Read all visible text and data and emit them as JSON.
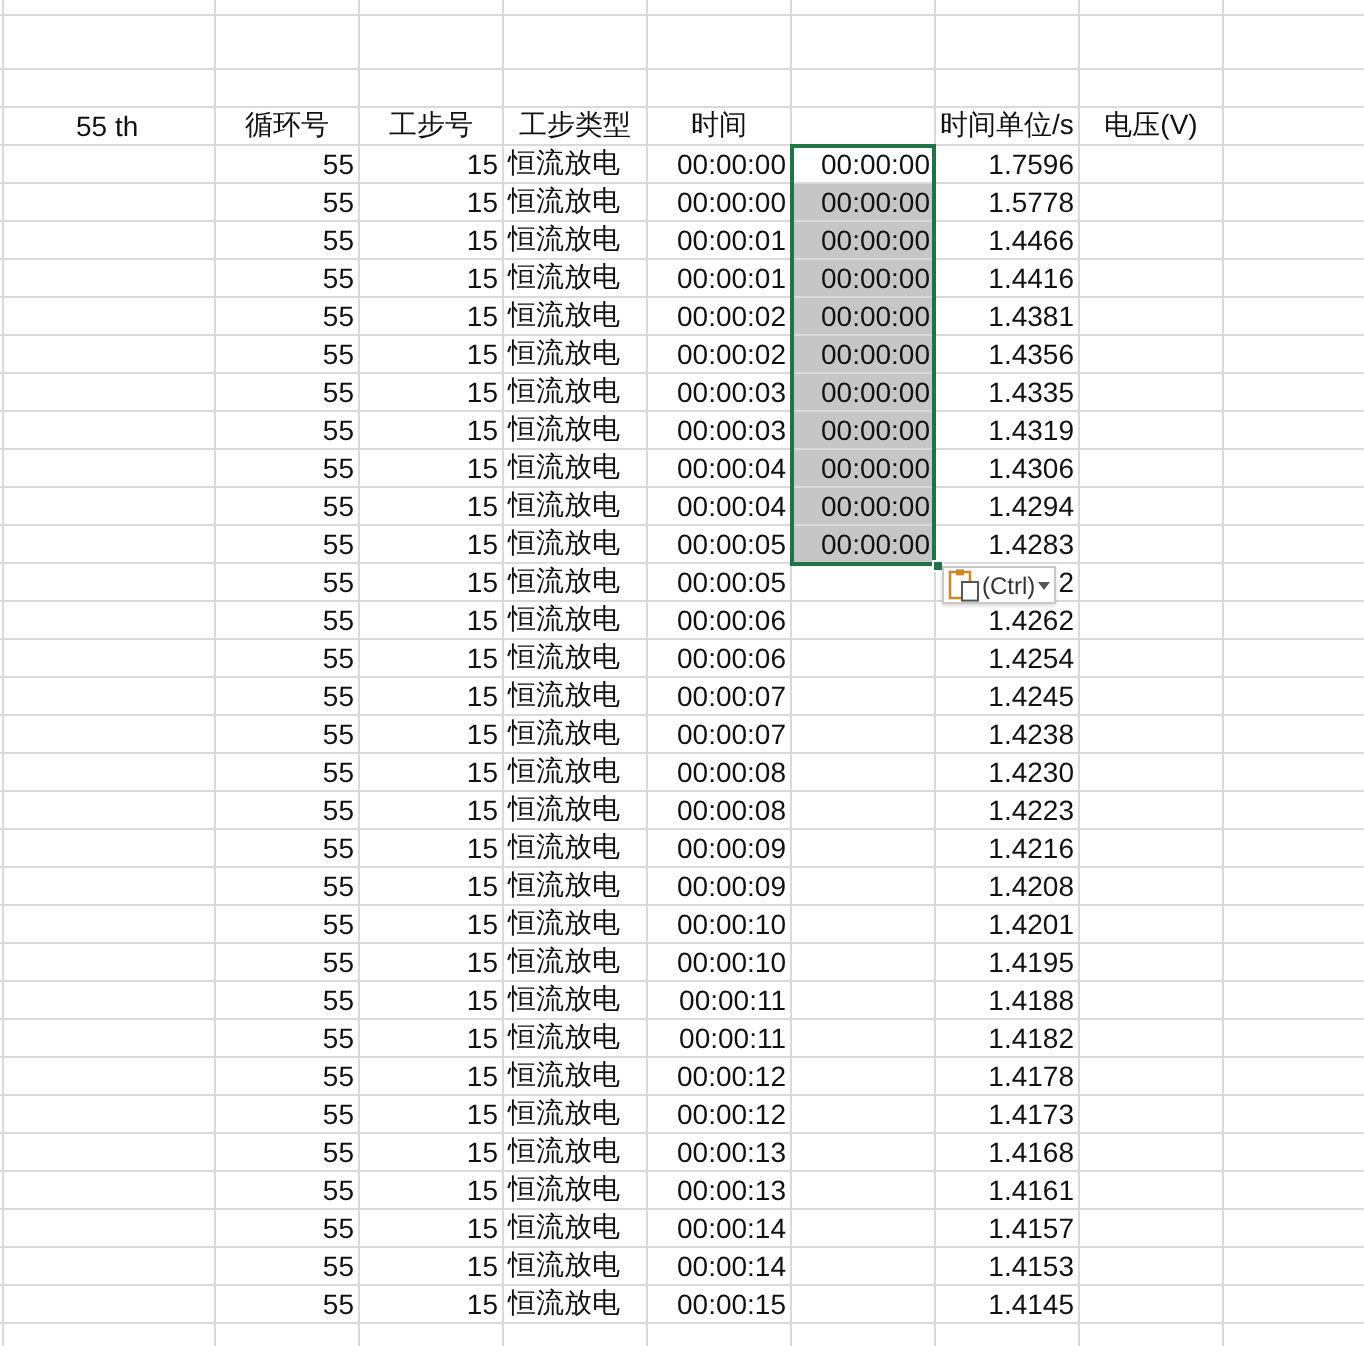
{
  "header_row": {
    "col_a": "55 th",
    "col_b": "循环号",
    "col_c": "工步号",
    "col_d": "工步类型",
    "col_e": "时间",
    "col_g": "时间单位/s",
    "col_h": "电压(V)"
  },
  "rows": [
    {
      "cycle": "55",
      "step": "15",
      "step_type": "恒流放电",
      "time": "00:00:00",
      "value": "1.7596"
    },
    {
      "cycle": "55",
      "step": "15",
      "step_type": "恒流放电",
      "time": "00:00:00",
      "value": "1.5778"
    },
    {
      "cycle": "55",
      "step": "15",
      "step_type": "恒流放电",
      "time": "00:00:01",
      "value": "1.4466"
    },
    {
      "cycle": "55",
      "step": "15",
      "step_type": "恒流放电",
      "time": "00:00:01",
      "value": "1.4416"
    },
    {
      "cycle": "55",
      "step": "15",
      "step_type": "恒流放电",
      "time": "00:00:02",
      "value": "1.4381"
    },
    {
      "cycle": "55",
      "step": "15",
      "step_type": "恒流放电",
      "time": "00:00:02",
      "value": "1.4356"
    },
    {
      "cycle": "55",
      "step": "15",
      "step_type": "恒流放电",
      "time": "00:00:03",
      "value": "1.4335"
    },
    {
      "cycle": "55",
      "step": "15",
      "step_type": "恒流放电",
      "time": "00:00:03",
      "value": "1.4319"
    },
    {
      "cycle": "55",
      "step": "15",
      "step_type": "恒流放电",
      "time": "00:00:04",
      "value": "1.4306"
    },
    {
      "cycle": "55",
      "step": "15",
      "step_type": "恒流放电",
      "time": "00:00:04",
      "value": "1.4294"
    },
    {
      "cycle": "55",
      "step": "15",
      "step_type": "恒流放电",
      "time": "00:00:05",
      "value": "1.4283"
    },
    {
      "cycle": "55",
      "step": "15",
      "step_type": "恒流放电",
      "time": "00:00:05",
      "value": "2"
    },
    {
      "cycle": "55",
      "step": "15",
      "step_type": "恒流放电",
      "time": "00:00:06",
      "value": "1.4262"
    },
    {
      "cycle": "55",
      "step": "15",
      "step_type": "恒流放电",
      "time": "00:00:06",
      "value": "1.4254"
    },
    {
      "cycle": "55",
      "step": "15",
      "step_type": "恒流放电",
      "time": "00:00:07",
      "value": "1.4245"
    },
    {
      "cycle": "55",
      "step": "15",
      "step_type": "恒流放电",
      "time": "00:00:07",
      "value": "1.4238"
    },
    {
      "cycle": "55",
      "step": "15",
      "step_type": "恒流放电",
      "time": "00:00:08",
      "value": "1.4230"
    },
    {
      "cycle": "55",
      "step": "15",
      "step_type": "恒流放电",
      "time": "00:00:08",
      "value": "1.4223"
    },
    {
      "cycle": "55",
      "step": "15",
      "step_type": "恒流放电",
      "time": "00:00:09",
      "value": "1.4216"
    },
    {
      "cycle": "55",
      "step": "15",
      "step_type": "恒流放电",
      "time": "00:00:09",
      "value": "1.4208"
    },
    {
      "cycle": "55",
      "step": "15",
      "step_type": "恒流放电",
      "time": "00:00:10",
      "value": "1.4201"
    },
    {
      "cycle": "55",
      "step": "15",
      "step_type": "恒流放电",
      "time": "00:00:10",
      "value": "1.4195"
    },
    {
      "cycle": "55",
      "step": "15",
      "step_type": "恒流放电",
      "time": "00:00:11",
      "value": "1.4188"
    },
    {
      "cycle": "55",
      "step": "15",
      "step_type": "恒流放电",
      "time": "00:00:11",
      "value": "1.4182"
    },
    {
      "cycle": "55",
      "step": "15",
      "step_type": "恒流放电",
      "time": "00:00:12",
      "value": "1.4178"
    },
    {
      "cycle": "55",
      "step": "15",
      "step_type": "恒流放电",
      "time": "00:00:12",
      "value": "1.4173"
    },
    {
      "cycle": "55",
      "step": "15",
      "step_type": "恒流放电",
      "time": "00:00:13",
      "value": "1.4168"
    },
    {
      "cycle": "55",
      "step": "15",
      "step_type": "恒流放电",
      "time": "00:00:13",
      "value": "1.4161"
    },
    {
      "cycle": "55",
      "step": "15",
      "step_type": "恒流放电",
      "time": "00:00:14",
      "value": "1.4157"
    },
    {
      "cycle": "55",
      "step": "15",
      "step_type": "恒流放电",
      "time": "00:00:14",
      "value": "1.4153"
    },
    {
      "cycle": "55",
      "step": "15",
      "step_type": "恒流放电",
      "time": "00:00:15",
      "value": "1.4145"
    }
  ],
  "pasted_column": [
    {
      "text": "00:00:00",
      "selected": true,
      "active": true
    },
    {
      "text": "00:00:00",
      "selected": true,
      "active": false
    },
    {
      "text": "00:00:00",
      "selected": true,
      "active": false
    },
    {
      "text": "00:00:00",
      "selected": true,
      "active": false
    },
    {
      "text": "00:00:00",
      "selected": true,
      "active": false
    },
    {
      "text": "00:00:00",
      "selected": true,
      "active": false
    },
    {
      "text": "00:00:00",
      "selected": true,
      "active": false
    },
    {
      "text": "00:00:00",
      "selected": true,
      "active": false
    },
    {
      "text": "00:00:00",
      "selected": true,
      "active": false
    },
    {
      "text": "00:00:00",
      "selected": true,
      "active": false
    },
    {
      "text": "00:00:00",
      "selected": true,
      "active": false
    }
  ],
  "paste_options": {
    "label": "(Ctrl)"
  }
}
